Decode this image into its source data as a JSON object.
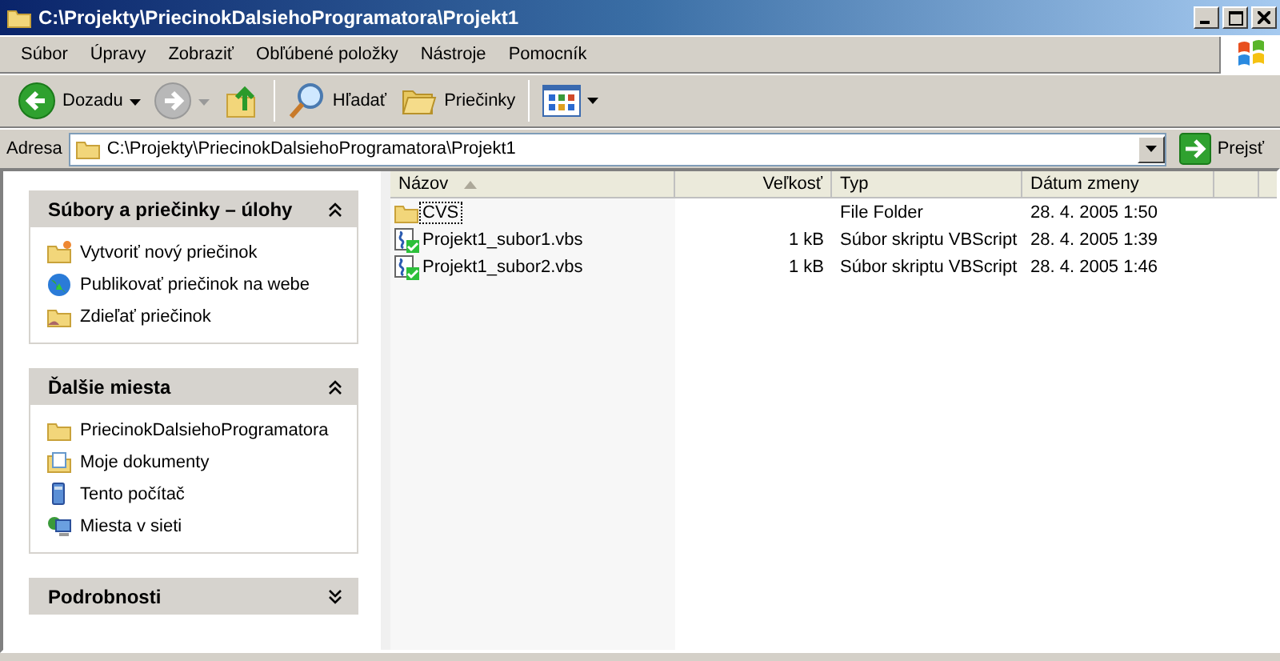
{
  "window": {
    "title": "C:\\Projekty\\PriecinokDalsiehoProgramatora\\Projekt1"
  },
  "menu": [
    "Súbor",
    "Úpravy",
    "Zobraziť",
    "Obľúbené položky",
    "Nástroje",
    "Pomocník"
  ],
  "toolbar": [
    {
      "kind": "back",
      "label": "Dozadu",
      "disabled": false
    },
    {
      "kind": "forward",
      "disabled": true
    },
    {
      "kind": "up"
    },
    {
      "kind": "search",
      "label": "Hľadať"
    },
    {
      "kind": "folders",
      "label": "Priečinky"
    },
    {
      "kind": "views"
    }
  ],
  "address": {
    "label": "Adresa",
    "value": "C:\\Projekty\\PriecinokDalsiehoProgramatora\\Projekt1",
    "go": "Prejsť"
  },
  "sidebar": [
    {
      "title": "Súbory a priečinky – úlohy",
      "expanded": true,
      "items": [
        {
          "kind": "newfolder",
          "label": "Vytvoriť nový priečinok"
        },
        {
          "kind": "globe",
          "label": "Publikovať priečinok na webe"
        },
        {
          "kind": "share",
          "label": "Zdieľať priečinok"
        }
      ]
    },
    {
      "title": "Ďalšie miesta",
      "expanded": true,
      "items": [
        {
          "kind": "folder",
          "label": "PriecinokDalsiehoProgramatora"
        },
        {
          "kind": "docs",
          "label": "Moje dokumenty"
        },
        {
          "kind": "computer",
          "label": "Tento počítač"
        },
        {
          "kind": "network",
          "label": "Miesta v sieti"
        }
      ]
    },
    {
      "title": "Podrobnosti",
      "expanded": false
    }
  ],
  "table": {
    "columns": [
      {
        "label": "Názov",
        "sorted": true
      },
      {
        "label": "Veľkosť",
        "sorted": false
      },
      {
        "label": "Typ",
        "sorted": false
      },
      {
        "label": "Dátum zmeny",
        "sorted": false
      }
    ],
    "rows": [
      {
        "kind": "folder",
        "name": "CVS",
        "type": "File Folder",
        "date": "28. 4. 2005 1:50",
        "focused": true
      },
      {
        "kind": "script",
        "name": "Projekt1_subor1.vbs",
        "size": "1 kB",
        "type": "Súbor skriptu VBScript",
        "date": "28. 4. 2005 1:39",
        "focused": false
      },
      {
        "kind": "script",
        "name": "Projekt1_subor2.vbs",
        "size": "1 kB",
        "type": "Súbor skriptu VBScript",
        "date": "28. 4. 2005 1:46",
        "focused": false
      }
    ]
  }
}
